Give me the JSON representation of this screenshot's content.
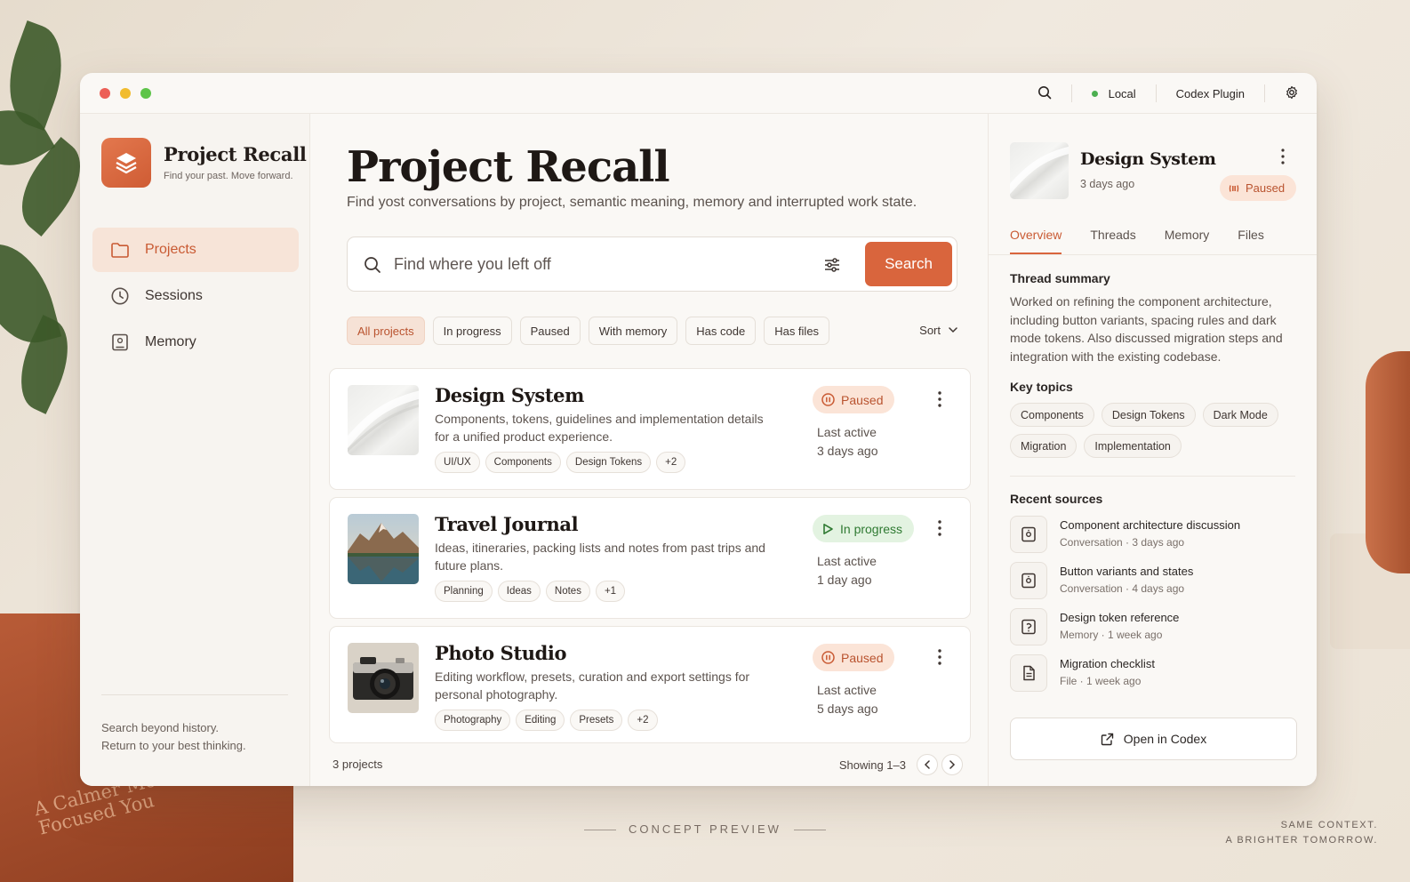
{
  "window": {
    "titlebar": {
      "status_label": "Local",
      "plugin_label": "Codex Plugin"
    }
  },
  "sidebar": {
    "brand_title": "Project Recall",
    "brand_tagline": "Find your past. Move forward.",
    "nav": [
      {
        "label": "Projects",
        "icon": "folder-icon",
        "active": true
      },
      {
        "label": "Sessions",
        "icon": "clock-icon",
        "active": false
      },
      {
        "label": "Memory",
        "icon": "memory-icon",
        "active": false
      }
    ],
    "footer_line1": "Search beyond history.",
    "footer_line2": "Return to your best thinking."
  },
  "main": {
    "title": "Project Recall",
    "subtitle": "Find yost conversations by project, semantic meaning, memory and interrupted work state.",
    "search": {
      "placeholder": "Find where you left off",
      "button": "Search"
    },
    "filters": [
      "All projects",
      "In progress",
      "Paused",
      "With memory",
      "Has code",
      "Has files"
    ],
    "sort_label": "Sort",
    "projects": [
      {
        "title": "Design System",
        "description": "Components, tokens, guidelines and implementation details for a unified product experience.",
        "tags": [
          "UI/UX",
          "Components",
          "Design Tokens",
          "+2"
        ],
        "status": "Paused",
        "last_active_label": "Last active",
        "last_active": "3 days ago"
      },
      {
        "title": "Travel Journal",
        "description": "Ideas, itineraries, packing lists and notes from past trips and future plans.",
        "tags": [
          "Planning",
          "Ideas",
          "Notes",
          "+1"
        ],
        "status": "In progress",
        "last_active_label": "Last active",
        "last_active": "1 day ago"
      },
      {
        "title": "Photo Studio",
        "description": "Editing workflow, presets, curation and export settings for personal photography.",
        "tags": [
          "Photography",
          "Editing",
          "Presets",
          "+2"
        ],
        "status": "Paused",
        "last_active_label": "Last active",
        "last_active": "5 days ago"
      }
    ],
    "count_label": "3 projects",
    "showing_label": "Showing 1–3"
  },
  "panel": {
    "title": "Design System",
    "subtitle": "3 days ago",
    "status": "Paused",
    "tabs": [
      "Overview",
      "Threads",
      "Memory",
      "Files"
    ],
    "summary_heading": "Thread summary",
    "summary": "Worked on refining the component architecture, including button variants, spacing rules and dark mode tokens. Also discussed migration steps and integration with the existing codebase.",
    "topics_heading": "Key topics",
    "topics": [
      "Components",
      "Design Tokens",
      "Dark Mode",
      "Migration",
      "Implementation"
    ],
    "sources_heading": "Recent sources",
    "sources": [
      {
        "title": "Component architecture discussion",
        "meta": "Conversation · 3 days ago",
        "icon": "conversation-icon"
      },
      {
        "title": "Button variants and states",
        "meta": "Conversation · 4 days ago",
        "icon": "conversation-icon"
      },
      {
        "title": "Design token reference",
        "meta": "Memory · 1 week ago",
        "icon": "memory-icon"
      },
      {
        "title": "Migration checklist",
        "meta": "File · 1 week ago",
        "icon": "file-icon"
      }
    ],
    "open_button": "Open in Codex"
  },
  "backdrop": {
    "book_text": "A Calmer More Focused You",
    "concept": "CONCEPT PREVIEW",
    "tagline1": "SAME CONTEXT.",
    "tagline2": "A BRIGHTER TOMORROW."
  },
  "colors": {
    "accent": "#d9653d",
    "paused_bg": "#fbe4d7",
    "progress_bg": "#e3f3e1",
    "progress_text": "#2f7a32"
  }
}
